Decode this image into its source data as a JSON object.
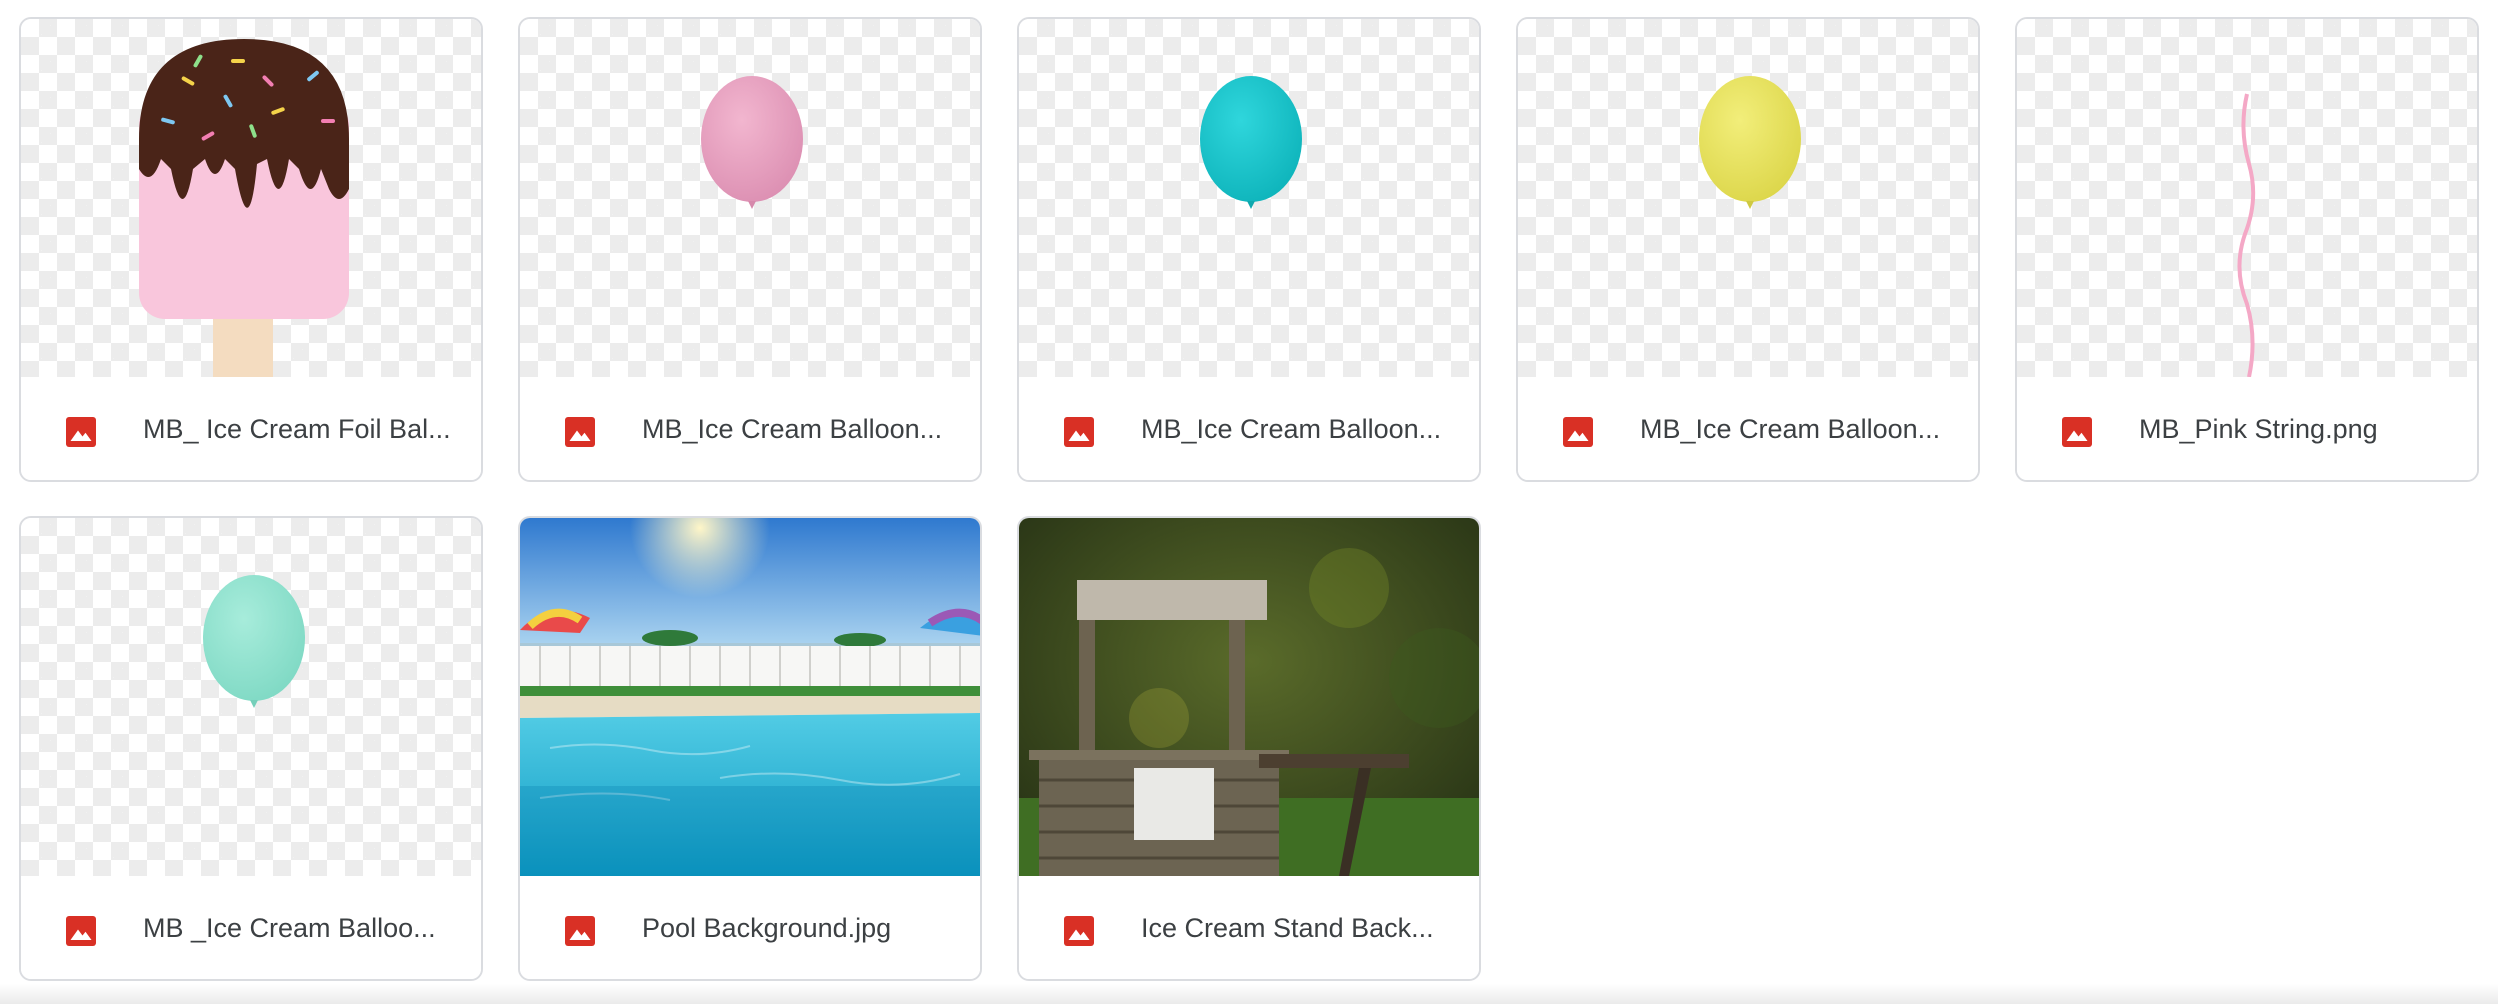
{
  "files": [
    {
      "name": "MB_ Ice Cream Foil Bal...",
      "icon": "image-file-icon"
    },
    {
      "name": "MB_Ice Cream Balloon...",
      "icon": "image-file-icon"
    },
    {
      "name": "MB_Ice Cream Balloon...",
      "icon": "image-file-icon"
    },
    {
      "name": "MB_Ice Cream Balloon...",
      "icon": "image-file-icon"
    },
    {
      "name": "MB_Pink String.png",
      "icon": "image-file-icon"
    },
    {
      "name": "MB _Ice Cream Balloo...",
      "icon": "image-file-icon"
    },
    {
      "name": "Pool Background.jpg",
      "icon": "image-file-icon"
    },
    {
      "name": "Ice Cream Stand Back...",
      "icon": "image-file-icon"
    }
  ],
  "colors": {
    "card_border": "#dadce0",
    "icon_red": "#d93025",
    "text": "#3c4043",
    "balloon_pink": "#e59bbd",
    "balloon_teal": "#18c4cb",
    "balloon_yellow": "#e8e45c",
    "balloon_mint": "#8fe3cf"
  }
}
